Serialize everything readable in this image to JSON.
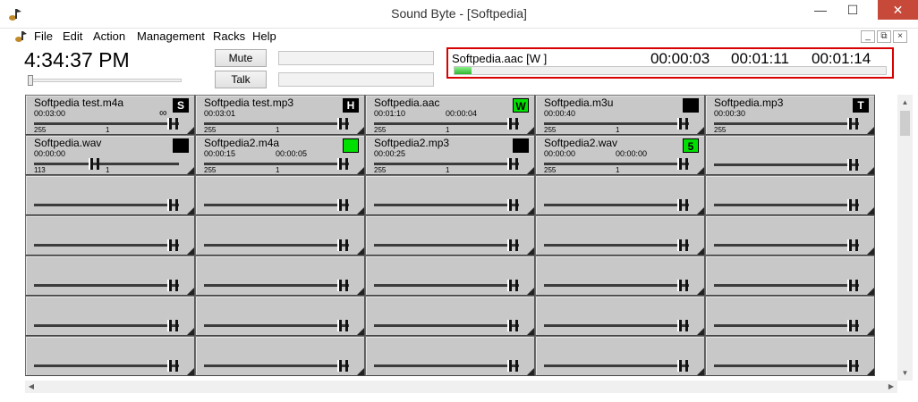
{
  "window": {
    "title": "Sound Byte - [Softpedia]",
    "minimize": "—",
    "maximize": "☐",
    "close": "✕"
  },
  "menu": {
    "items": [
      "File",
      "Edit",
      "Action",
      "Management",
      "Racks",
      "Help"
    ],
    "mdi": [
      "_",
      "⧉",
      "×"
    ]
  },
  "clock": "4:34:37 PM",
  "buttons": {
    "mute": "Mute",
    "talk": "Talk"
  },
  "now_playing": {
    "title": "Softpedia.aac  [W ]",
    "elapsed": "00:00:03",
    "remaining": "00:01:11",
    "total": "00:01:14",
    "progress": 0.04
  },
  "cells": [
    {
      "name": "Softpedia test.m4a",
      "t1": "00:03:00",
      "t2": "",
      "vol": "255",
      "pan": "1",
      "badge": "S",
      "badge_style": "black",
      "loop": "∞",
      "slider": 0.98
    },
    {
      "name": "Softpedia test.mp3",
      "t1": "00:03:01",
      "t2": "",
      "vol": "255",
      "pan": "1",
      "badge": "H",
      "badge_style": "black",
      "loop": "",
      "slider": 0.98
    },
    {
      "name": "Softpedia.aac",
      "t1": "00:01:10",
      "t2": "00:00:04",
      "vol": "255",
      "pan": "1",
      "badge": "W",
      "badge_style": "green",
      "loop": "",
      "slider": 0.98
    },
    {
      "name": "Softpedia.m3u",
      "t1": "00:00:40",
      "t2": "",
      "vol": "255",
      "pan": "1",
      "badge": "",
      "badge_style": "black",
      "loop": "",
      "slider": 0.98
    },
    {
      "name": "Softpedia.mp3",
      "t1": "00:00:30",
      "t2": "",
      "vol": "255",
      "pan": "",
      "badge": "T",
      "badge_style": "black",
      "loop": "",
      "slider": 0.98
    },
    {
      "name": "Softpedia.wav",
      "t1": "00:00:00",
      "t2": "",
      "vol": "113",
      "pan": "1",
      "badge": "",
      "badge_style": "black",
      "loop": "",
      "slider": 0.44
    },
    {
      "name": "Softpedia2.m4a",
      "t1": "00:00:15",
      "t2": "00:00:05",
      "vol": "255",
      "pan": "1",
      "badge": "",
      "badge_style": "green",
      "loop": "",
      "slider": 0.98
    },
    {
      "name": "Softpedia2.mp3",
      "t1": "00:00:25",
      "t2": "",
      "vol": "255",
      "pan": "1",
      "badge": "",
      "badge_style": "black",
      "loop": "",
      "slider": 0.98
    },
    {
      "name": "Softpedia2.wav",
      "t1": "00:00:00",
      "t2": "00:00:00",
      "vol": "255",
      "pan": "1",
      "badge": "5",
      "badge_style": "green",
      "loop": "",
      "slider": 0.98
    },
    {
      "name": "",
      "t1": "",
      "t2": "",
      "vol": "",
      "pan": "",
      "badge": "",
      "badge_style": "none",
      "loop": "",
      "slider": 0.98
    }
  ],
  "empty_rows": 5,
  "columns": 5,
  "scroll": {
    "up": "▲",
    "down": "▼",
    "left": "◀",
    "right": "▶"
  },
  "colors": {
    "accent_red": "#d80000",
    "badge_green": "#00e000",
    "cell_bg": "#c8c8c8"
  }
}
